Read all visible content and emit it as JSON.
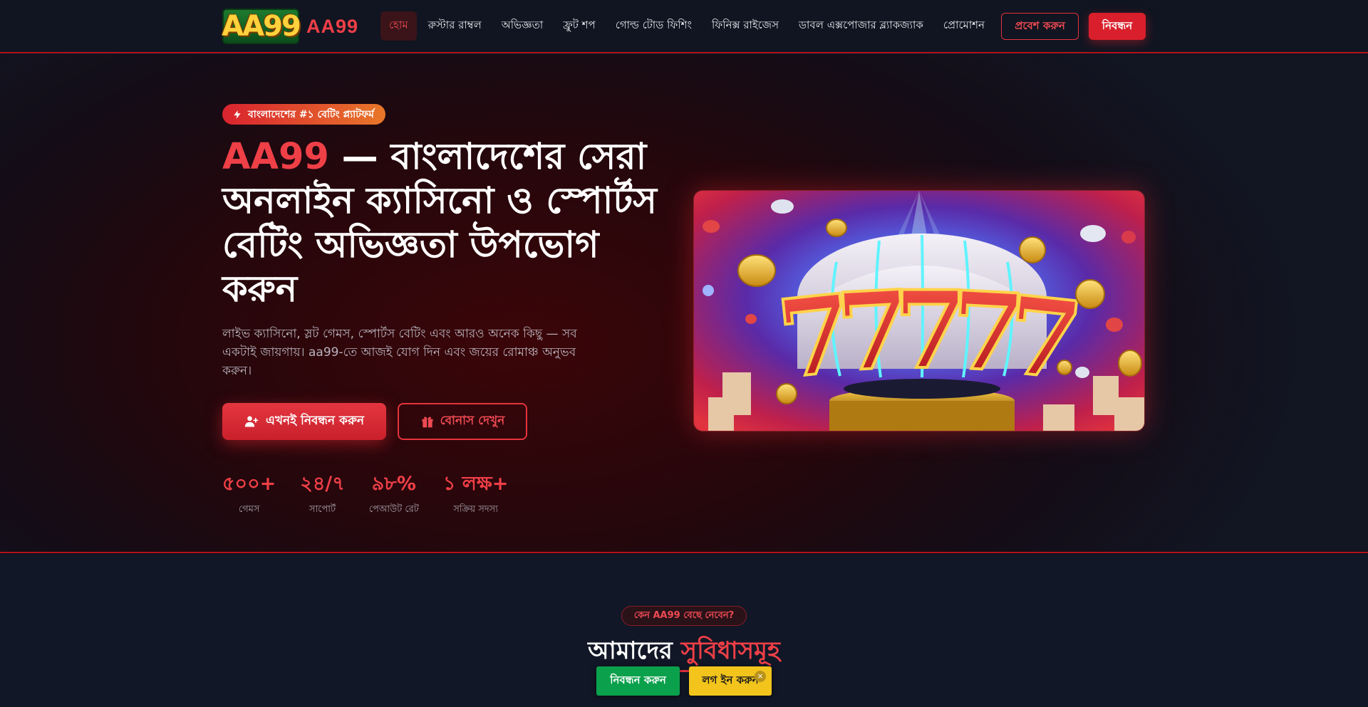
{
  "brand": {
    "logo_text": "AA99",
    "name": "AA99"
  },
  "nav": {
    "items": [
      {
        "label": "হোম",
        "active": true
      },
      {
        "label": "রুস্টার রাম্বল",
        "active": false
      },
      {
        "label": "অভিজ্ঞতা",
        "active": false
      },
      {
        "label": "ফ্রুট শপ",
        "active": false
      },
      {
        "label": "গোল্ড টোড ফিশিং",
        "active": false
      },
      {
        "label": "ফিনিক্স রাইজেস",
        "active": false
      },
      {
        "label": "ডাবল এক্সপোজার ব্ল্যাকজ্যাক",
        "active": false
      },
      {
        "label": "প্রোমোশন",
        "active": false
      }
    ],
    "login_label": "প্রবেশ করুন",
    "register_label": "নিবন্ধন"
  },
  "hero": {
    "badge": "বাংলাদেশের #১ বেটিং প্ল্যাটফর্ম",
    "title_brand": "AA99",
    "title_rest": " — বাংলাদেশের সেরা অনলাইন ক্যাসিনো ও স্পোর্টস বেটিং অভিজ্ঞতা উপভোগ করুন",
    "subtitle": "লাইভ ক্যাসিনো, স্লট গেমস, স্পোর্টস বেটিং এবং আরও অনেক কিছু — সব একটাই জায়গায়। aa99-তে আজই যোগ দিন এবং জয়ের রোমাঞ্চ অনুভব করুন।",
    "cta_label": "এখনই নিবন্ধন করুন",
    "bonus_label": "বোনাস দেখুন",
    "stats": [
      {
        "value": "৫০০+",
        "label": "গেমস"
      },
      {
        "value": "২৪/৭",
        "label": "সাপোর্ট"
      },
      {
        "value": "৯৮%",
        "label": "পেআউট রেট"
      },
      {
        "value": "১ লক্ষ+",
        "label": "সক্রিয় সদস্য"
      }
    ]
  },
  "features": {
    "tag": "কেন AA99 বেছে নেবেন?",
    "title_main": "আমাদের ",
    "title_accent": "সুবিধাসমূহ"
  },
  "floating_bar": {
    "register_label": "নিবন্ধন করুন",
    "login_label": "লগ ইন করুন",
    "close_glyph": "×"
  },
  "colors": {
    "accent": "#e5333d",
    "background": "#0f1420",
    "hero_glow": "#3b0508",
    "float_green": "#0ba14c",
    "float_yellow": "#f2c41c"
  },
  "icons": [
    "bolt-icon",
    "user-plus-icon",
    "gift-icon",
    "close-icon"
  ]
}
